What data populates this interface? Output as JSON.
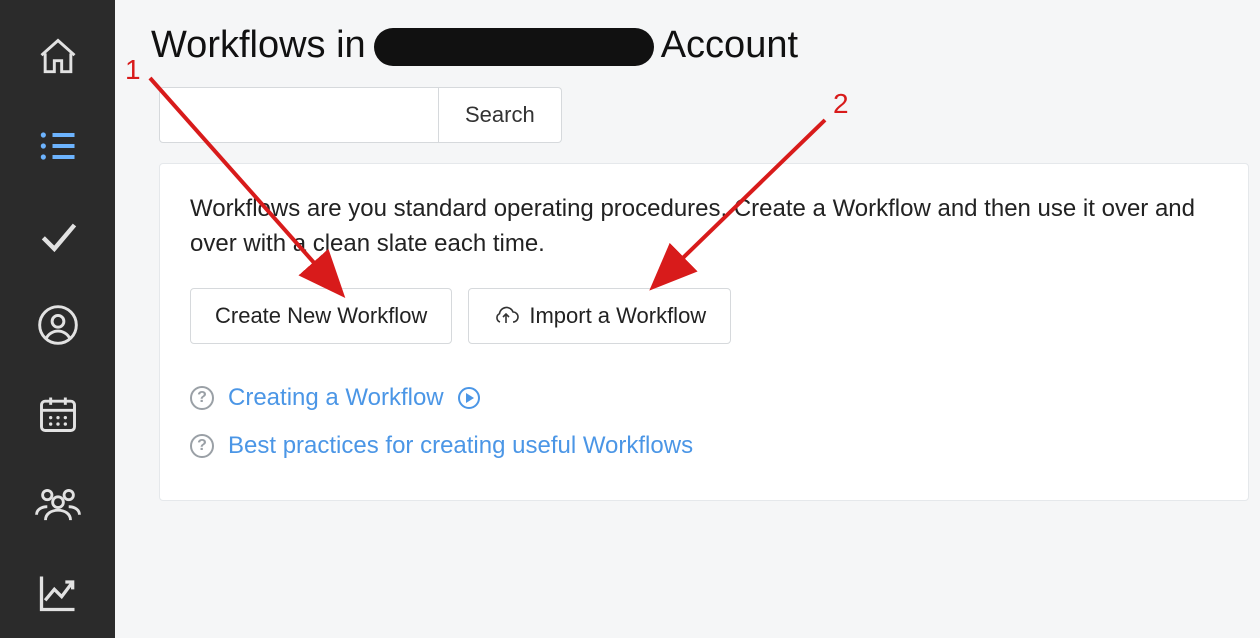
{
  "sidebar": {
    "items": [
      {
        "name": "home-icon"
      },
      {
        "name": "list-icon"
      },
      {
        "name": "check-icon"
      },
      {
        "name": "user-icon"
      },
      {
        "name": "calendar-icon"
      },
      {
        "name": "team-icon"
      },
      {
        "name": "chart-icon"
      }
    ]
  },
  "page": {
    "title_prefix": "Workflows in ",
    "title_suffix": " Account"
  },
  "search": {
    "value": "",
    "button_label": "Search"
  },
  "card": {
    "intro": "Workflows are you standard operating procedures. Create a Workflow and then use it over and over with a clean slate each time.",
    "create_label": "Create New Workflow",
    "import_label": "Import a Workflow"
  },
  "help": {
    "link1": "Creating a Workflow",
    "link2": "Best practices for creating useful Workflows"
  },
  "annotations": {
    "label1": "1",
    "label2": "2",
    "color": "#d81b1b"
  }
}
